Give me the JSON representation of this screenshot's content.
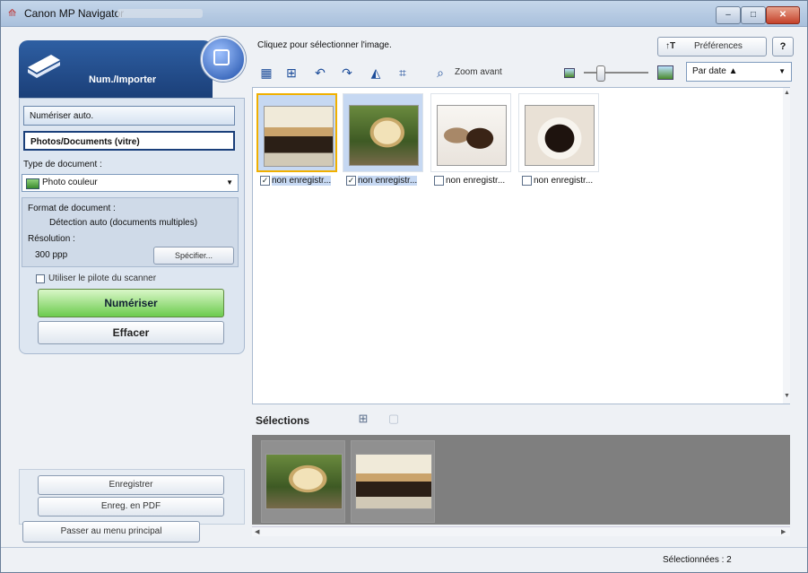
{
  "window": {
    "title": "Canon MP Navigator",
    "buttons": {
      "minimize": "–",
      "maximize": "□",
      "close": "✕"
    }
  },
  "left": {
    "header_title": "Num./Importer",
    "modes": {
      "auto": "Numériser auto.",
      "photo": "Photos/Documents (vitre)"
    },
    "doc_type_label": "Type de document :",
    "doc_type_value": "Photo couleur",
    "format_label": "Format de document :",
    "format_value": "Détection auto (documents multiples)",
    "resolution_label": "Résolution :",
    "resolution_value": "300 ppp",
    "specify_button": "Spécifier...",
    "driver_checkbox_label": "Utiliser le pilote du scanner",
    "scan_button": "Numériser",
    "clear_button": "Effacer",
    "save_button": "Enregistrer",
    "save_pdf_button": "Enreg. en PDF",
    "main_menu_button": "Passer au menu principal"
  },
  "right": {
    "instruction": "Cliquez pour sélectionner l'image.",
    "preferences_icon": "↑T",
    "preferences_button": "Préférences",
    "help_button": "?",
    "zoom_label": "Zoom avant",
    "sort_value": "Par date ▲",
    "thumbnails": [
      {
        "caption": "non enregistr...",
        "checked": true,
        "selected": true,
        "focused": true
      },
      {
        "caption": "non enregistr...",
        "checked": true,
        "selected": true,
        "focused": false
      },
      {
        "caption": "non enregistr...",
        "checked": false,
        "selected": false,
        "focused": false
      },
      {
        "caption": "non enregistr...",
        "checked": false,
        "selected": false,
        "focused": false
      }
    ],
    "selections_label": "Sélections",
    "selected_count": 2,
    "zoom_slider_fraction": 0.25
  },
  "status": {
    "text": "Sélectionnées : 2"
  },
  "icons": [
    "scanner-icon",
    "globe-icon",
    "select-all-icon",
    "grid-icon",
    "rotate-left-icon",
    "rotate-right-icon",
    "mirror-icon",
    "crop-icon",
    "zoom-icon",
    "small-image-icon",
    "large-image-icon",
    "check-icon"
  ]
}
